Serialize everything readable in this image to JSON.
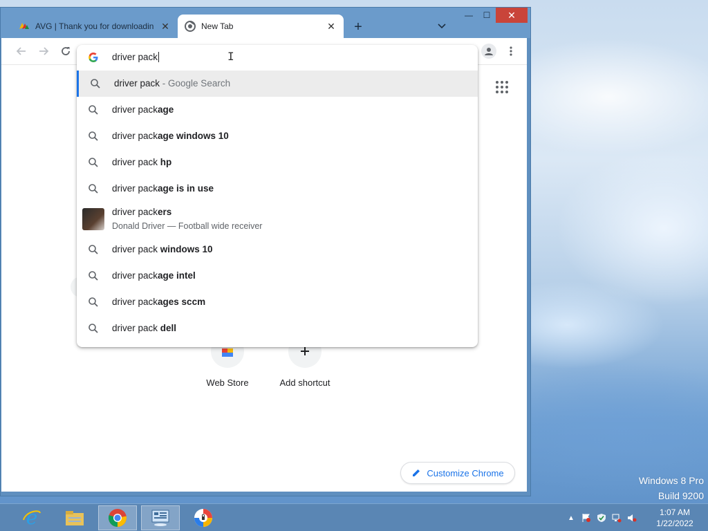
{
  "desktop": {
    "watermark_line1": "Windows 8 Pro",
    "watermark_line2": "Build 9200"
  },
  "browser": {
    "tabs": [
      {
        "title": "AVG | Thank you for downloadin",
        "favicon": "avg-icon",
        "active": false
      },
      {
        "title": "New Tab",
        "favicon": "chrome-icon",
        "active": true
      }
    ],
    "new_tab_symbol": "+",
    "window_controls": {
      "minimize": "—",
      "maximize": "☐",
      "close": "✕"
    }
  },
  "omnibox": {
    "typed_text": "driver pack",
    "suggestions": [
      {
        "prefix": "driver pack",
        "suffix": "",
        "dim": " - Google Search",
        "type": "search",
        "selected": true
      },
      {
        "prefix": "driver pack",
        "suffix": "age",
        "dim": "",
        "type": "search"
      },
      {
        "prefix": "driver pack",
        "suffix": "age windows 10",
        "dim": "",
        "type": "search"
      },
      {
        "prefix": "driver pack ",
        "suffix": "hp",
        "dim": "",
        "type": "search"
      },
      {
        "prefix": "driver pack",
        "suffix": "age is in use",
        "dim": "",
        "type": "search"
      },
      {
        "prefix": "driver pack",
        "suffix": "ers",
        "dim": "",
        "type": "entity",
        "subtitle": "Donald Driver — Football wide receiver"
      },
      {
        "prefix": "driver pack ",
        "suffix": "windows 10",
        "dim": "",
        "type": "search"
      },
      {
        "prefix": "driver pack",
        "suffix": "age intel",
        "dim": "",
        "type": "search"
      },
      {
        "prefix": "driver pack",
        "suffix": "ages sccm",
        "dim": "",
        "type": "search"
      },
      {
        "prefix": "driver pack ",
        "suffix": "dell",
        "dim": "",
        "type": "search"
      }
    ]
  },
  "ntp": {
    "shortcuts": [
      {
        "label": "Web Store",
        "icon": "webstore-icon"
      },
      {
        "label": "Add shortcut",
        "icon": "plus-icon"
      }
    ],
    "customize_label": "Customize Chrome"
  },
  "taskbar": {
    "items": [
      "internet-explorer-icon",
      "file-explorer-icon",
      "chrome-icon",
      "control-panel-icon",
      "avg-secure-browser-icon"
    ],
    "clock_time": "1:07 AM",
    "clock_date": "1/22/2022"
  },
  "colors": {
    "accent": "#1a73e8",
    "close_red": "#c9443a",
    "taskbar": "#5a86b4"
  }
}
